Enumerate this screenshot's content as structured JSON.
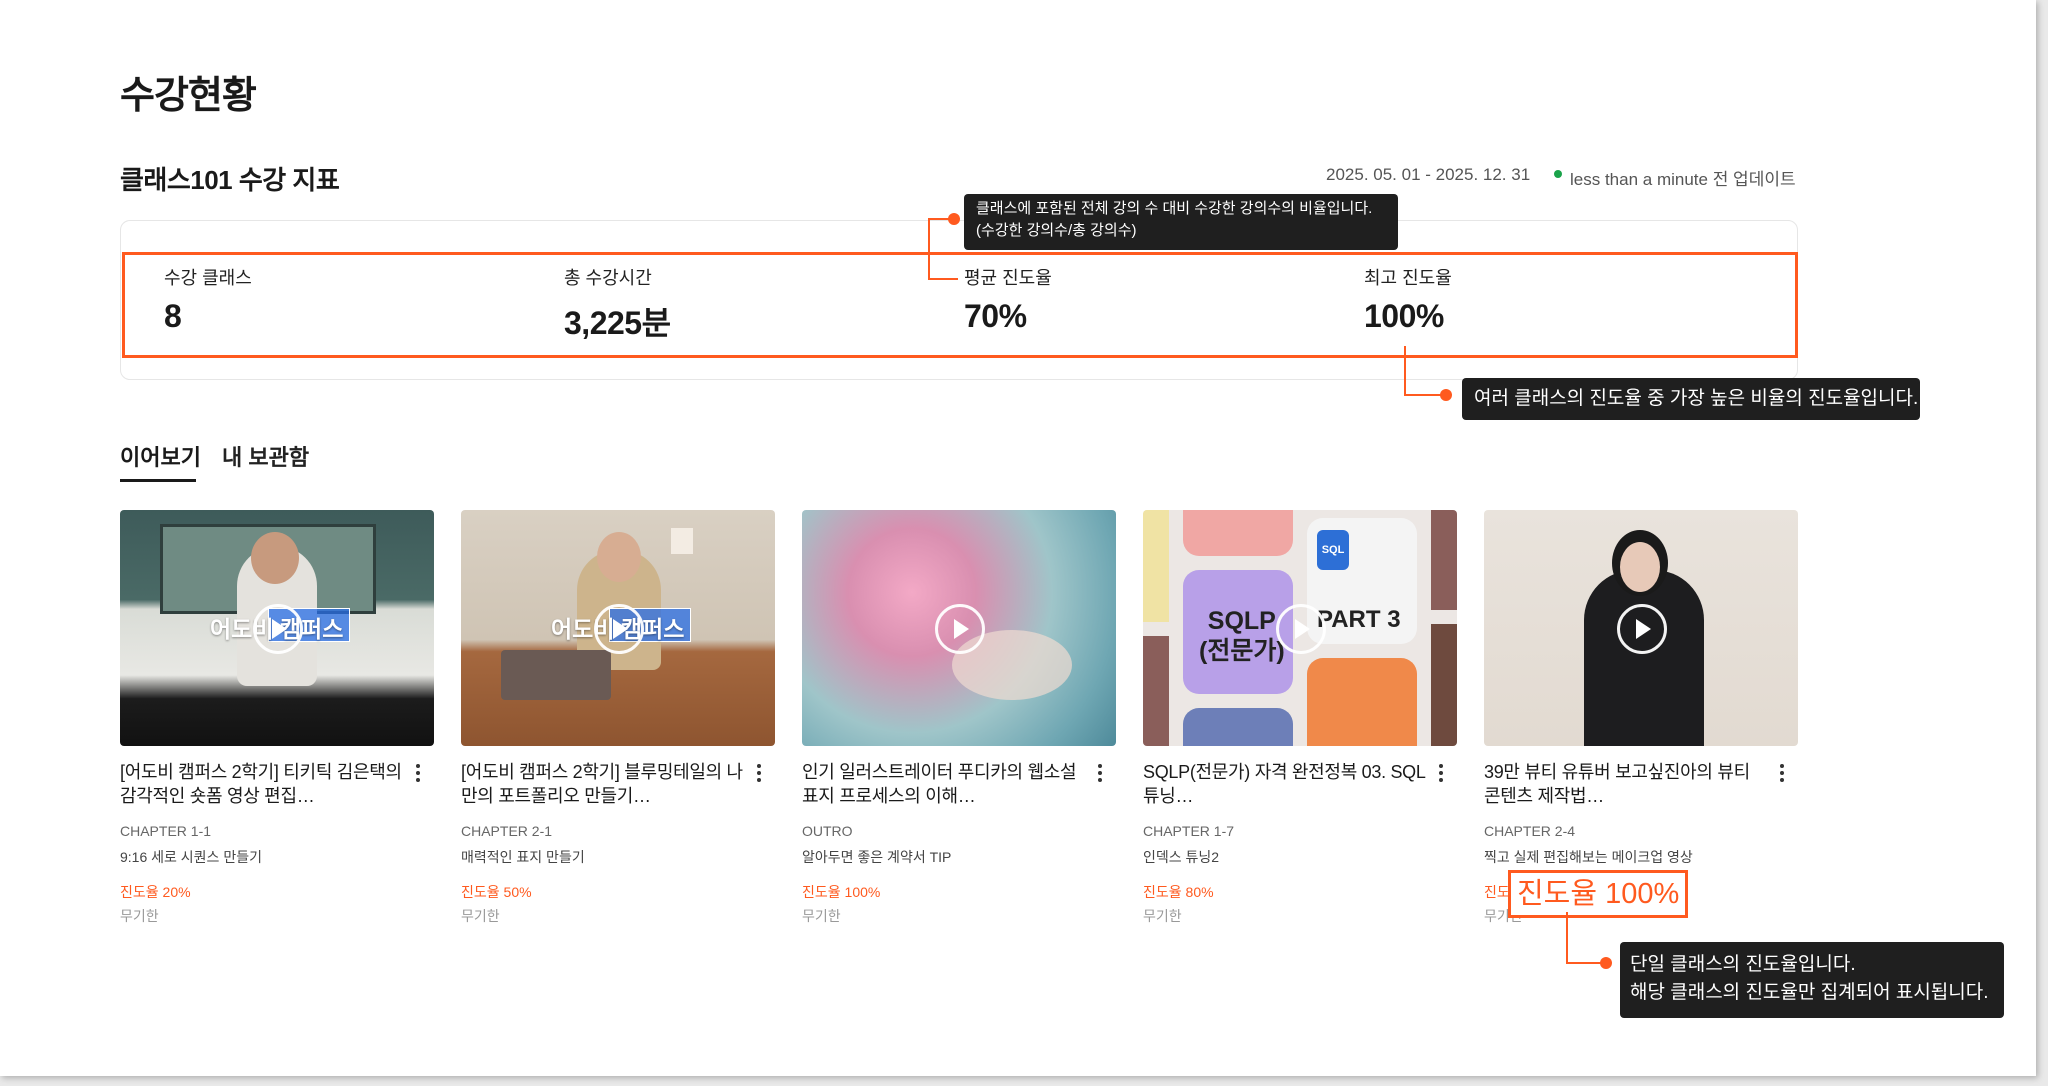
{
  "page": {
    "title": "수강현황",
    "section_title": "클래스101 수강 지표",
    "date_range": "2025. 05. 01 - 2025. 12. 31",
    "updated": "less than a minute 전 업데이트"
  },
  "stats": [
    {
      "label": "수강 클래스",
      "value": "8"
    },
    {
      "label": "총 수강시간",
      "value": "3,225분"
    },
    {
      "label": "평균 진도율",
      "value": "70%"
    },
    {
      "label": "최고 진도율",
      "value": "100%"
    }
  ],
  "tooltips": {
    "avg_line1": "클래스에 포함된 전체 강의 수 대비 수강한 강의수의 비율입니다.",
    "avg_line2": "(수강한 강의수/총 강의수)",
    "max": "여러 클래스의 진도율 중 가장 높은 비율의 진도율입니다.",
    "single_line1": "단일 클래스의 진도율입니다.",
    "single_line2": "해당 클래스의 진도율만 집계되어 표시됩니다."
  },
  "tabs": [
    {
      "label": "이어보기",
      "active": true
    },
    {
      "label": "내 보관함",
      "active": false
    }
  ],
  "thumb_logo": "어도비 캠퍼스",
  "thumb_sql": {
    "title_line1": "SQLP",
    "title_line2": "(전문가)",
    "part": "PART 3",
    "badge": "SQL"
  },
  "cards": [
    {
      "title": "[어도비 캠퍼스 2학기] 티키틱 김은택의 감각적인 숏폼 영상 편집…",
      "chapter": "CHAPTER 1-1",
      "lesson": "9:16 세로 시퀀스 만들기",
      "progress": "진도율 20%",
      "period": "무기한"
    },
    {
      "title": "[어도비 캠퍼스 2학기] 블루밍테일의 나만의 포트폴리오 만들기…",
      "chapter": "CHAPTER 2-1",
      "lesson": "매력적인 표지 만들기",
      "progress": "진도율 50%",
      "period": "무기한"
    },
    {
      "title": "인기 일러스트레이터 푸디카의 웹소설 표지 프로세스의 이해…",
      "chapter": "OUTRO",
      "lesson": "알아두면 좋은 계약서 TIP",
      "progress": "진도율 100%",
      "period": "무기한"
    },
    {
      "title": "SQLP(전문가) 자격 완전정복 03. SQL 튜닝…",
      "chapter": "CHAPTER 1-7",
      "lesson": "인덱스 튜닝2",
      "progress": "진도율 80%",
      "period": "무기한"
    },
    {
      "title": "39만 뷰티 유튜버 보고싶진아의 뷰티 콘텐츠 제작법…",
      "chapter": "CHAPTER 2-4",
      "lesson": "찍고 실제 편집해보는 메이크업 영상",
      "progress": "진도율 100%",
      "period": "무기한"
    }
  ],
  "zoom_progress": "진도율 100%",
  "colors": {
    "accent": "#ff5a1f",
    "status_green": "#1aa34a",
    "tooltip_bg": "#1f1f1f"
  }
}
